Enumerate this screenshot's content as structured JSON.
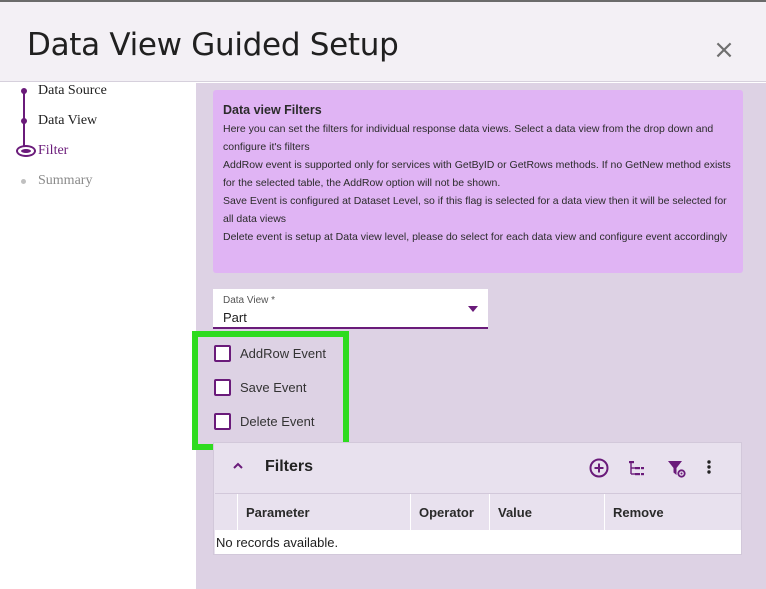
{
  "dialog": {
    "title": "Data View Guided Setup",
    "close_symbol": "×"
  },
  "steps": [
    {
      "label": "Data Source",
      "state": "done"
    },
    {
      "label": "Data View",
      "state": "done"
    },
    {
      "label": "Filter",
      "state": "active"
    },
    {
      "label": "Summary",
      "state": "pending"
    }
  ],
  "info": {
    "title": "Data view Filters",
    "lines": [
      "Here you can set the filters for individual response data views. Select a data view from the drop down and configure it's filters",
      "AddRow event is supported only for services with GetByID or GetRows methods. If no GetNew method exists for the selected table, the AddRow option will not be shown.",
      "Save Event is configured at Dataset Level, so if this flag is selected for a data view then it will be selected for all data views",
      "Delete event is setup at Data view level, please do select for each data view and configure event accordingly"
    ]
  },
  "dataview": {
    "label": "Data View *",
    "value": "Part"
  },
  "checkboxes": [
    {
      "label": "AddRow Event",
      "checked": false
    },
    {
      "label": "Save Event",
      "checked": false
    },
    {
      "label": "Delete Event",
      "checked": false
    }
  ],
  "filters": {
    "title": "Filters",
    "columns": [
      "Parameter",
      "Operator",
      "Value",
      "Remove"
    ],
    "empty_text": "No records available."
  },
  "colors": {
    "accent": "#6a1b7a",
    "info_bg": "#e0b4f4",
    "main_bg": "#ddd2e4",
    "highlight": "#2edb1f"
  }
}
